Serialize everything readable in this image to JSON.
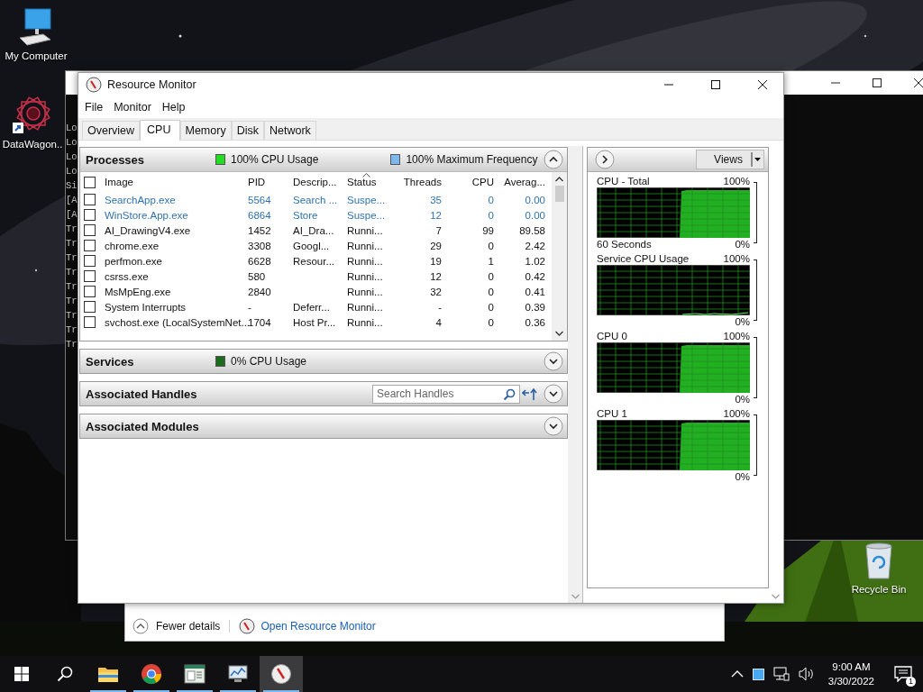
{
  "desktop_icons": [
    {
      "kind": "computer",
      "label": "My Computer"
    },
    {
      "kind": "app",
      "label": "DataWagon.."
    },
    {
      "kind": "recycle",
      "label": "Recycle Bin"
    }
  ],
  "console": {
    "lines": [
      "Lo",
      "Lo",
      "Lo",
      "Lo",
      "Si",
      "[A",
      "[A",
      "Tr",
      "Tr",
      "Tr",
      "Tr",
      "Tr",
      "Tr",
      "Tr",
      "Tr",
      "Tr"
    ]
  },
  "task_manager": {
    "details_toggle": "Fewer details",
    "link": "Open Resource Monitor"
  },
  "resource_monitor": {
    "title": "Resource Monitor",
    "menu": [
      "File",
      "Monitor",
      "Help"
    ],
    "tabs": [
      {
        "label": "Overview",
        "selected": false
      },
      {
        "label": "CPU",
        "selected": true
      },
      {
        "label": "Memory",
        "selected": false
      },
      {
        "label": "Disk",
        "selected": false
      },
      {
        "label": "Network",
        "selected": false
      }
    ],
    "sections": [
      {
        "title": "Processes",
        "expanded": true,
        "legend": [
          {
            "text": "100% CPU Usage",
            "color": "#22dd22"
          },
          {
            "text": "100% Maximum Frequency",
            "color": "#7fb8ee"
          }
        ],
        "table": {
          "all_checked": false,
          "columns": [
            {
              "label": "Image",
              "sorted": false
            },
            {
              "label": "PID",
              "sorted": false
            },
            {
              "label": "Descrip...",
              "sorted": false
            },
            {
              "label": "Status",
              "sorted": true
            },
            {
              "label": "Threads",
              "sorted": false
            },
            {
              "label": "CPU",
              "sorted": false
            },
            {
              "label": "Averag...",
              "sorted": false
            }
          ],
          "rows": [
            {
              "checked": false,
              "suspended": true,
              "cells": [
                "SearchApp.exe",
                "5564",
                "Search ...",
                "Suspe...",
                "35",
                "0",
                "0.00"
              ]
            },
            {
              "checked": false,
              "suspended": true,
              "cells": [
                "WinStore.App.exe",
                "6864",
                "Store",
                "Suspe...",
                "12",
                "0",
                "0.00"
              ]
            },
            {
              "checked": false,
              "suspended": false,
              "cells": [
                "AI_DrawingV4.exe",
                "1452",
                "AI_Dra...",
                "Runni...",
                "7",
                "99",
                "89.58"
              ]
            },
            {
              "checked": false,
              "suspended": false,
              "cells": [
                "chrome.exe",
                "3308",
                "Googl...",
                "Runni...",
                "29",
                "0",
                "2.42"
              ]
            },
            {
              "checked": false,
              "suspended": false,
              "cells": [
                "perfmon.exe",
                "6628",
                "Resour...",
                "Runni...",
                "19",
                "1",
                "1.02"
              ]
            },
            {
              "checked": false,
              "suspended": false,
              "cells": [
                "csrss.exe",
                "580",
                "",
                "Runni...",
                "12",
                "0",
                "0.42"
              ]
            },
            {
              "checked": false,
              "suspended": false,
              "cells": [
                "MsMpEng.exe",
                "2840",
                "",
                "Runni...",
                "32",
                "0",
                "0.41"
              ]
            },
            {
              "checked": false,
              "suspended": false,
              "cells": [
                "System Interrupts",
                "-",
                "Deferr...",
                "Runni...",
                "-",
                "0",
                "0.39"
              ]
            },
            {
              "checked": false,
              "suspended": false,
              "cells": [
                "svchost.exe (LocalSystemNet...",
                "1704",
                "Host Pr...",
                "Runni...",
                "4",
                "0",
                "0.36"
              ]
            }
          ]
        }
      },
      {
        "title": "Services",
        "expanded": false,
        "legend": [
          {
            "text": "0% CPU Usage",
            "color": "#1d6b1d"
          }
        ]
      },
      {
        "title": "Associated Handles",
        "expanded": false,
        "search": {
          "placeholder": "Search Handles"
        }
      },
      {
        "title": "Associated Modules",
        "expanded": false
      }
    ],
    "views_button": "Views",
    "graphs": [
      {
        "kind": "busy",
        "title": "CPU - Total",
        "max": "100%",
        "min": "0%",
        "footer": "60 Seconds"
      },
      {
        "kind": "idle",
        "title": "Service CPU Usage",
        "max": "100%",
        "min": "0%"
      },
      {
        "kind": "busy",
        "title": "CPU 0",
        "max": "100%",
        "min": "0%"
      },
      {
        "kind": "busy",
        "title": "CPU 1",
        "max": "100%",
        "min": "0%"
      }
    ]
  },
  "taskbar": {
    "apps": [
      {
        "kind": "folder",
        "running": true,
        "selected": false
      },
      {
        "kind": "browser",
        "running": true,
        "selected": false
      },
      {
        "kind": "document",
        "running": true,
        "selected": false
      },
      {
        "kind": "monitor",
        "running": true,
        "selected": false
      },
      {
        "kind": "gauge",
        "running": true,
        "selected": true
      }
    ],
    "time": "9:00 AM",
    "date": "3/30/2022",
    "notifications": "1"
  }
}
